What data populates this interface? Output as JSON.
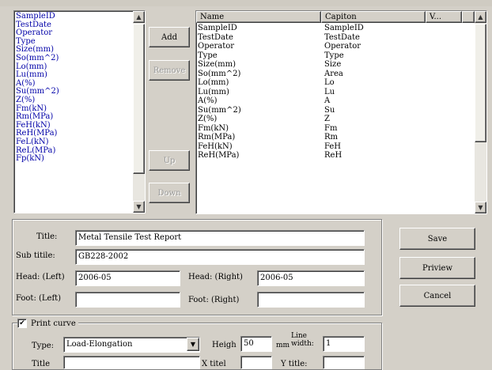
{
  "left_list": {
    "items": [
      "SampleID",
      "TestDate",
      "Operator",
      "Type",
      "Size(mm)",
      "So(mm^2)",
      "Lo(mm)",
      "Lu(mm)",
      "A(%)",
      "Su(mm^2)",
      "Z(%)",
      "Fm(kN)",
      "Rm(MPa)",
      "FeH(kN)",
      "ReH(MPa)",
      "FeL(kN)",
      "ReL(MPa)",
      "Fp(kN)"
    ]
  },
  "buttons": {
    "add": "Add",
    "remove": "Remove",
    "up": "Up",
    "down": "Down",
    "save": "Save",
    "preview": "Priview",
    "cancel": "Cancel"
  },
  "grid": {
    "headers": [
      "Name",
      "Capiton",
      "V..."
    ],
    "rows": [
      [
        "SampleID",
        "SampleID"
      ],
      [
        "TestDate",
        "TestDate"
      ],
      [
        "Operator",
        "Operator"
      ],
      [
        "Type",
        "Type"
      ],
      [
        "Size(mm)",
        "Size"
      ],
      [
        "So(mm^2)",
        "Area"
      ],
      [
        "Lo(mm)",
        "Lo"
      ],
      [
        "Lu(mm)",
        "Lu"
      ],
      [
        "A(%)",
        "A"
      ],
      [
        "Su(mm^2)",
        "Su"
      ],
      [
        "Z(%)",
        "Z"
      ],
      [
        "Fm(kN)",
        "Fm"
      ],
      [
        "Rm(MPa)",
        "Rm"
      ],
      [
        "FeH(kN)",
        "FeH"
      ],
      [
        "ReH(MPa)",
        "ReH"
      ]
    ]
  },
  "form": {
    "title_label": "Title:",
    "title_value": "Metal Tensile Test Report",
    "subtitle_label": "Sub titile:",
    "subtitle_value": "GB228-2002",
    "head_left_label": "Head: (Left)",
    "head_left_value": "2006-05",
    "head_right_label": "Head: (Right)",
    "head_right_value": "2006-05",
    "foot_left_label": "Foot: (Left)",
    "foot_left_value": "",
    "foot_right_label": "Foot: (Right)",
    "foot_right_value": ""
  },
  "curve": {
    "print_label": "Print curve",
    "print_checked": true,
    "type_label": "Type:",
    "type_value": "Load-Elongation",
    "height_label": "Heigh",
    "height_value": "50",
    "height_unit": "mm",
    "line_width_label": "Line\nwidth:",
    "line_width_value": "1",
    "title_label": "Title",
    "title_value": "",
    "x_title_label": "X titel",
    "x_title_value": "",
    "y_title_label": "Y title:",
    "y_title_value": ""
  }
}
